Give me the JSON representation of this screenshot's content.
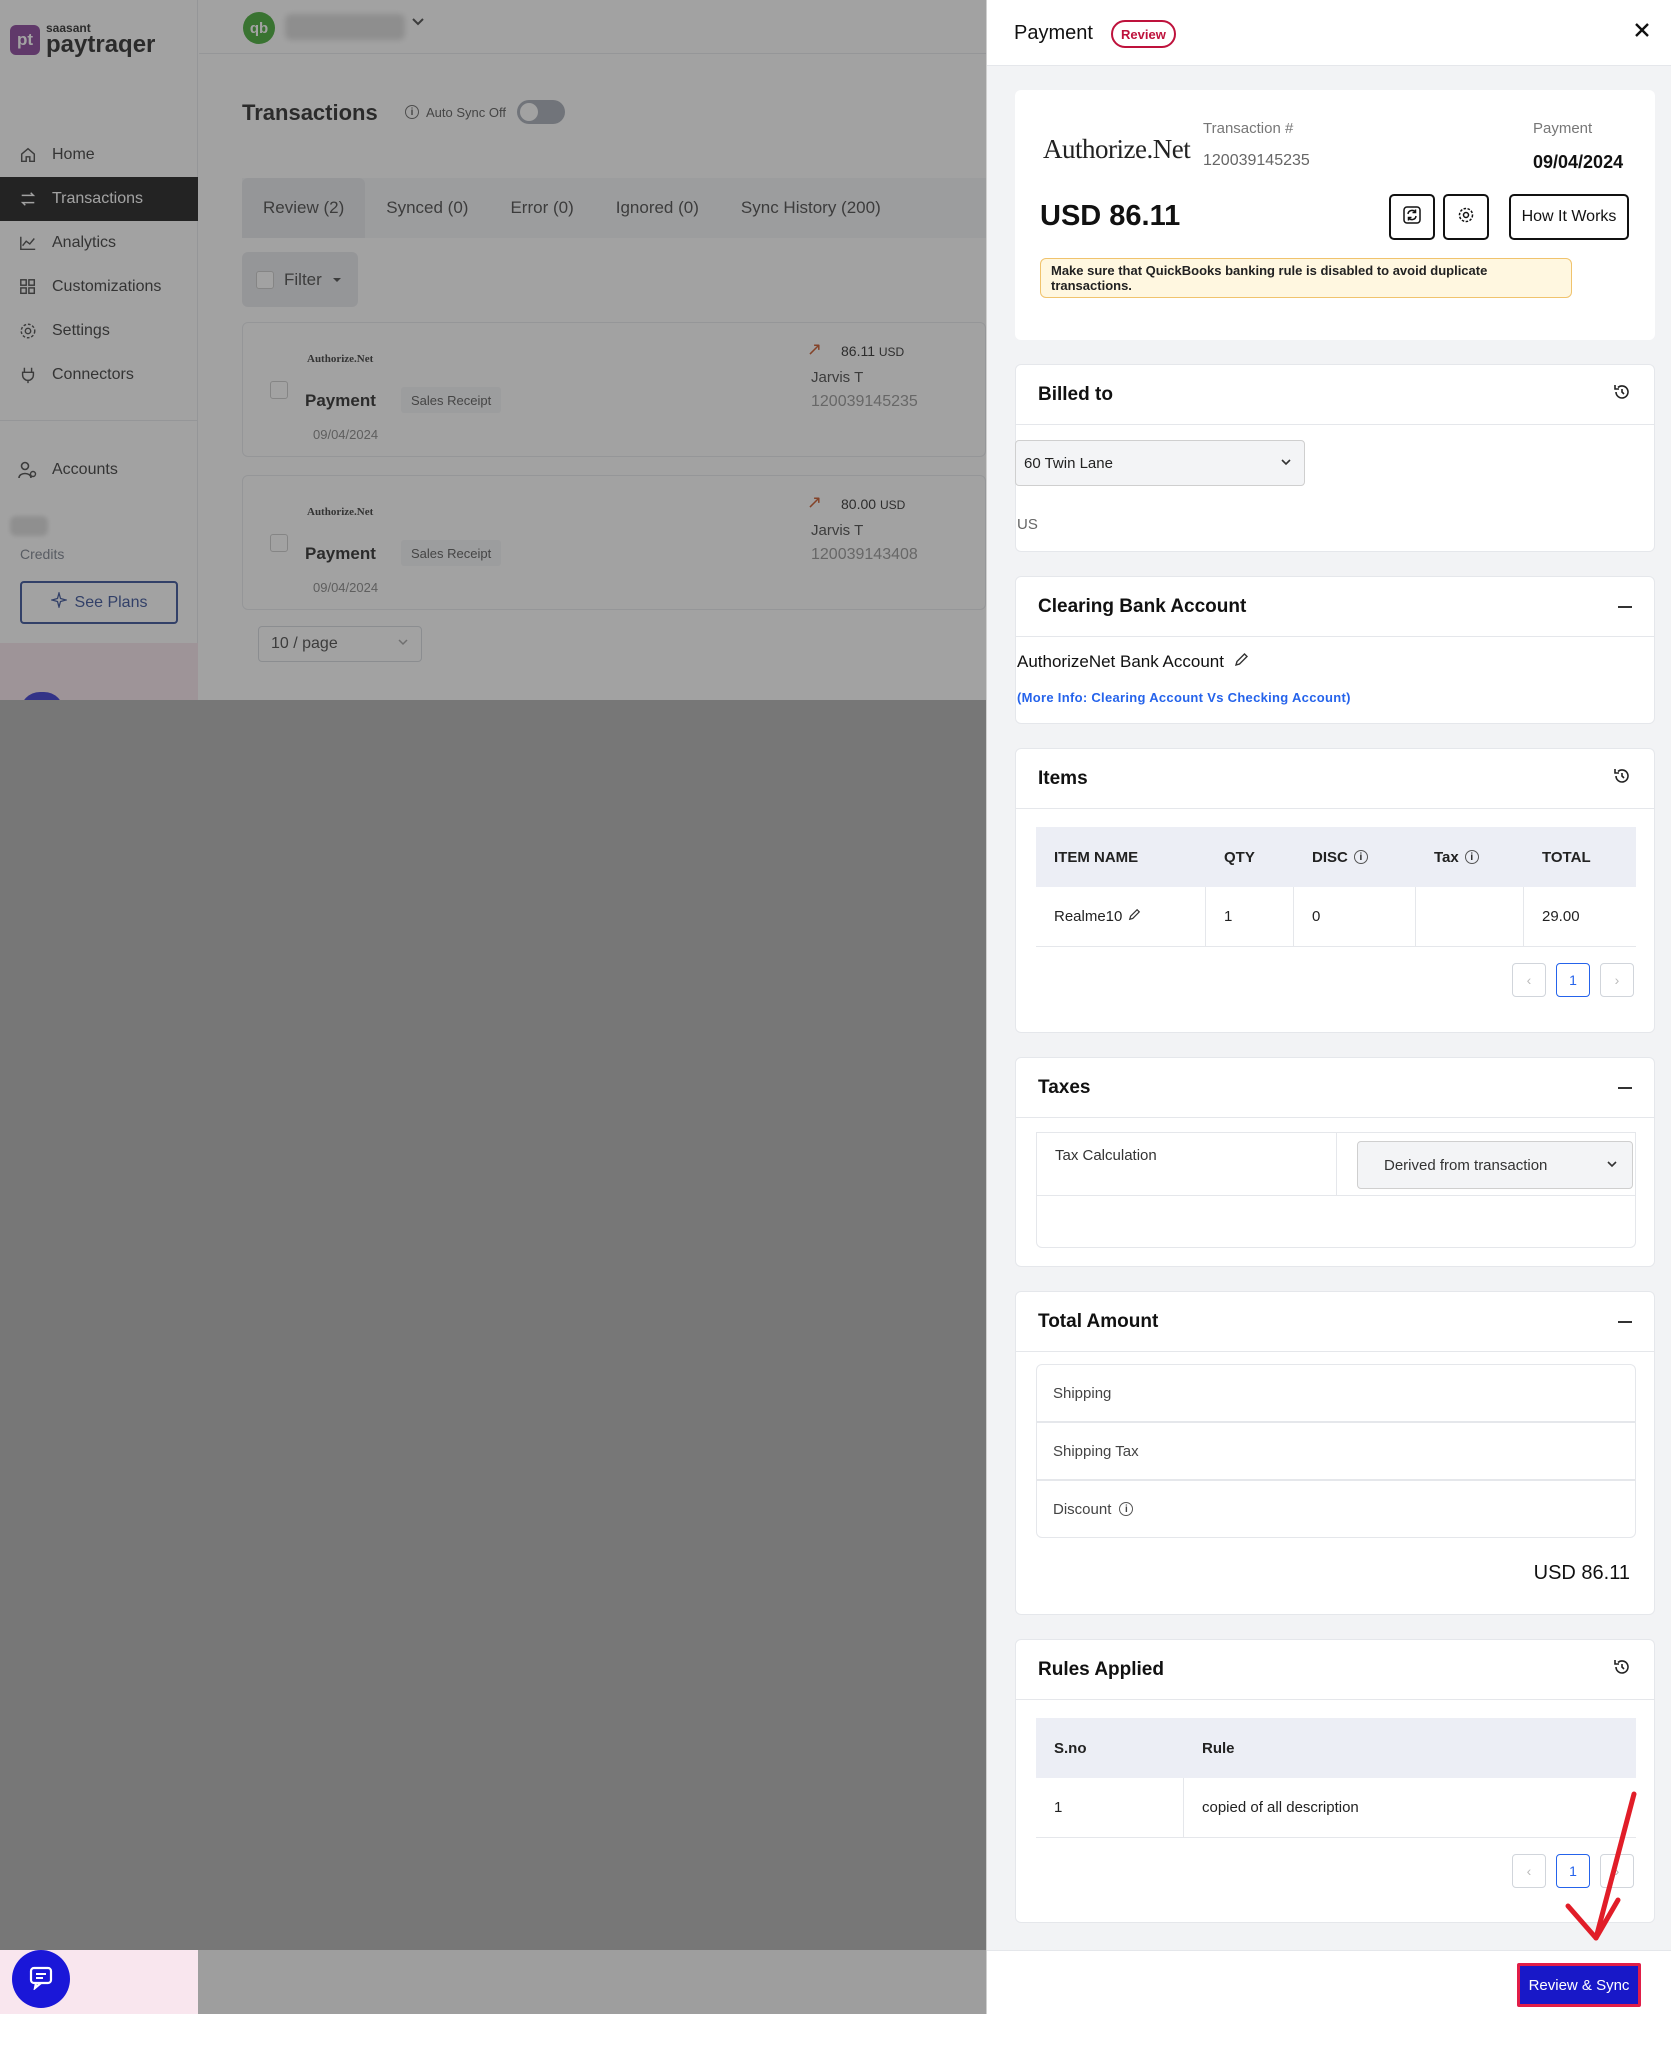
{
  "app": {
    "logo_small": "saasant",
    "logo_big": "paytraqer",
    "logo_mark": "pt"
  },
  "sidebar": {
    "items": [
      {
        "label": "Home",
        "icon": "home-icon"
      },
      {
        "label": "Transactions",
        "icon": "transfer-icon",
        "active": true
      },
      {
        "label": "Analytics",
        "icon": "chart-icon"
      },
      {
        "label": "Customizations",
        "icon": "grid-icon"
      },
      {
        "label": "Settings",
        "icon": "gear-icon"
      },
      {
        "label": "Connectors",
        "icon": "plug-icon"
      }
    ],
    "accounts_label": "Accounts",
    "credits_label": "Credits",
    "see_plans_label": "See Plans"
  },
  "topbar": {
    "qb_icon_text": "qb"
  },
  "main": {
    "title": "Transactions",
    "autosync_label": "Auto Sync Off",
    "tabs": [
      "Review (2)",
      "Synced (0)",
      "Error (0)",
      "Ignored (0)",
      "Sync History (200)"
    ],
    "filter_label": "Filter",
    "transactions": [
      {
        "brand": "Authorize.Net",
        "type": "Payment",
        "badge": "Sales Receipt",
        "date": "09/04/2024",
        "amount": "86.11",
        "currency": "USD",
        "name": "Jarvis T",
        "number": "120039145235"
      },
      {
        "brand": "Authorize.Net",
        "type": "Payment",
        "badge": "Sales Receipt",
        "date": "09/04/2024",
        "amount": "80.00",
        "currency": "USD",
        "name": "Jarvis T",
        "number": "120039143408"
      }
    ],
    "page_size": "10 / page"
  },
  "drawer": {
    "title": "Payment",
    "status": "Review",
    "summary": {
      "brand": "Authorize.Net",
      "txn_label": "Transaction #",
      "txn_value": "120039145235",
      "pay_label": "Payment",
      "pay_date": "09/04/2024",
      "amount": "USD 86.11",
      "how_it_works": "How It Works",
      "warning": "Make sure that QuickBooks banking rule is disabled to avoid duplicate transactions."
    },
    "billed_to": {
      "title": "Billed to",
      "address": "60 Twin Lane",
      "country": "US"
    },
    "clearing": {
      "title": "Clearing Bank Account",
      "account": "AuthorizeNet Bank Account",
      "link": "(More Info: Clearing Account Vs Checking Account)"
    },
    "items": {
      "title": "Items",
      "columns": [
        "ITEM NAME",
        "QTY",
        "DISC",
        "Tax",
        "TOTAL"
      ],
      "rows": [
        {
          "name": "Realme10",
          "qty": "1",
          "disc": "0",
          "tax": "",
          "total": "29.00"
        }
      ],
      "page": "1"
    },
    "taxes": {
      "title": "Taxes",
      "calc_label": "Tax Calculation",
      "calc_value": "Derived from transaction"
    },
    "total": {
      "title": "Total Amount",
      "shipping": "Shipping",
      "shipping_tax": "Shipping Tax",
      "discount": "Discount",
      "amount": "USD 86.11"
    },
    "rules": {
      "title": "Rules Applied",
      "columns": [
        "S.no",
        "Rule"
      ],
      "rows": [
        {
          "sno": "1",
          "rule": "copied of all description"
        }
      ],
      "page": "1"
    },
    "sync_button": "Review & Sync"
  }
}
